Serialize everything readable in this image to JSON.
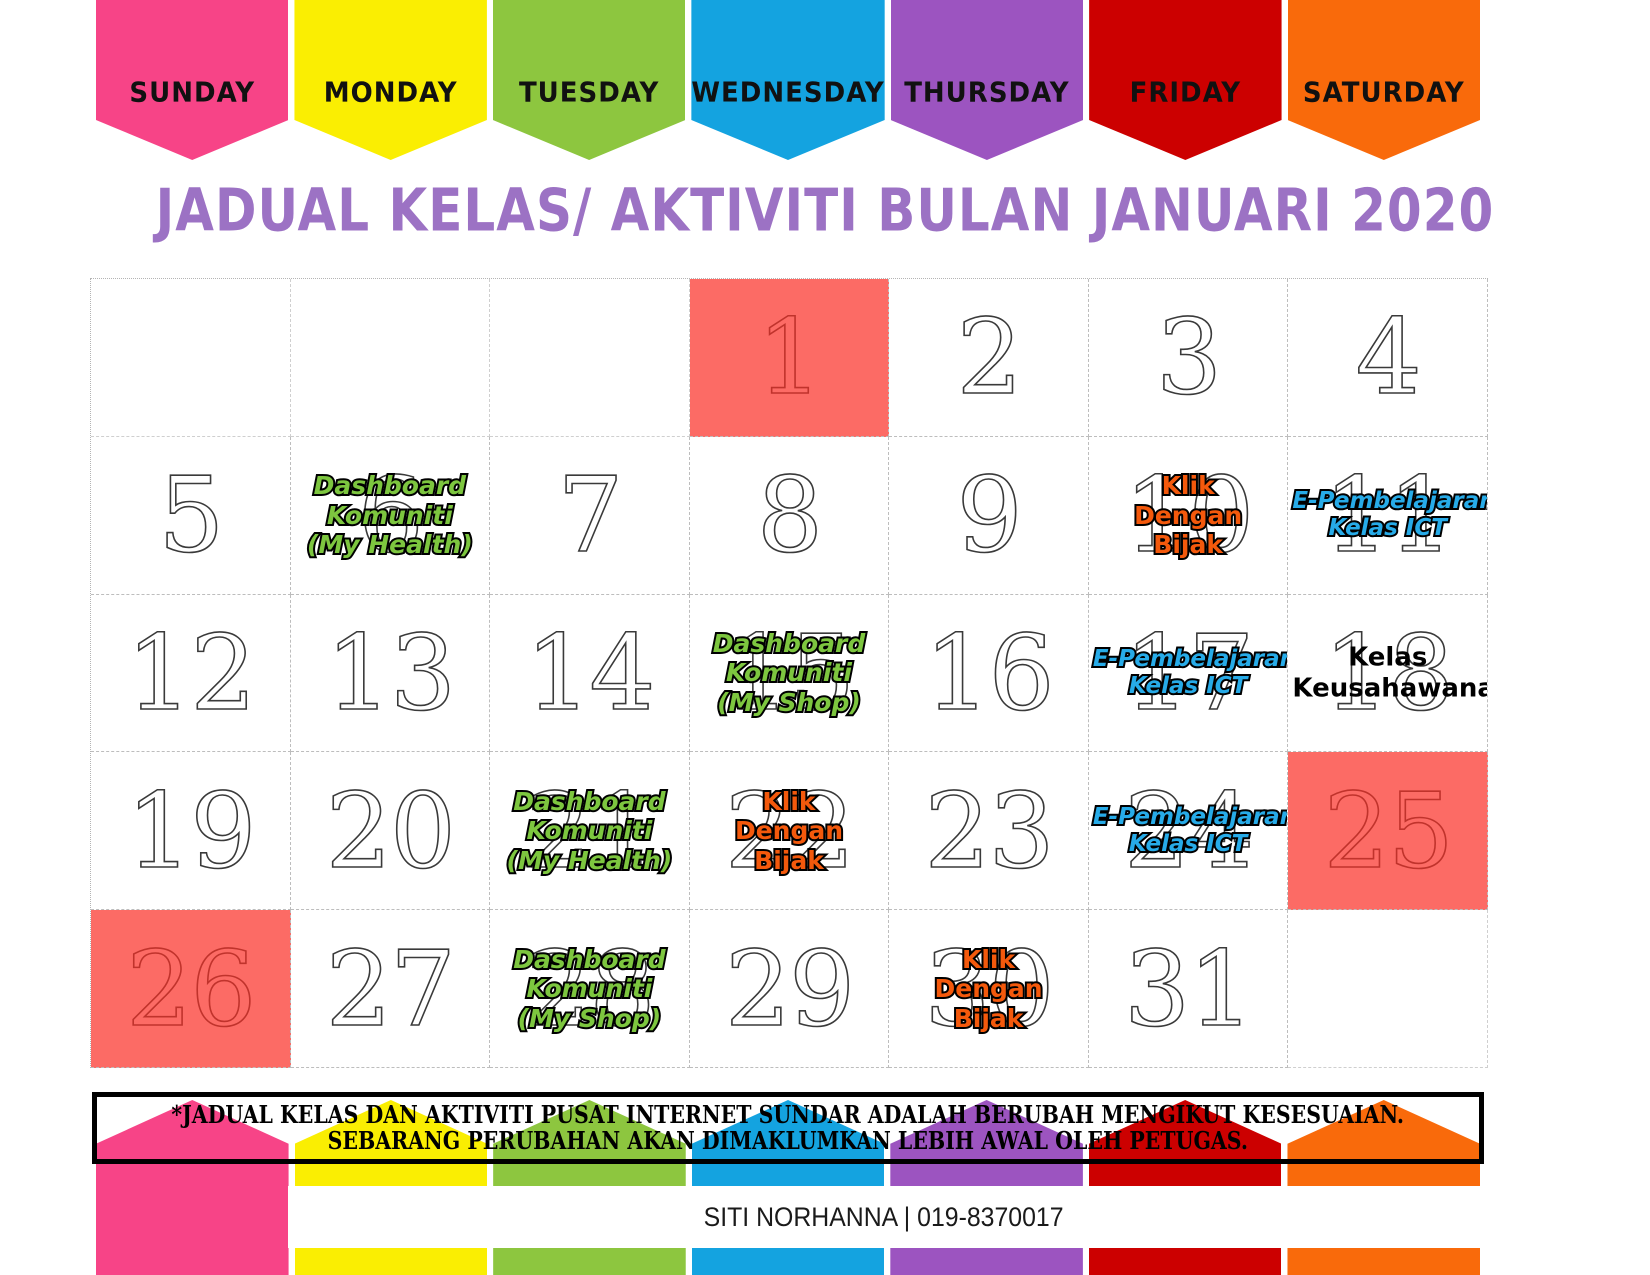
{
  "title": "JADUAL KELAS/ AKTIVITI BULAN JANUARI 2020",
  "days": [
    {
      "label": "SUNDAY",
      "color": "#F74487"
    },
    {
      "label": "MONDAY",
      "color": "#FAEE02"
    },
    {
      "label": "TUESDAY",
      "color": "#8DC63F"
    },
    {
      "label": "WEDNESDAY",
      "color": "#14A3E0"
    },
    {
      "label": "THURSDAY",
      "color": "#9C54C0"
    },
    {
      "label": "FRIDAY",
      "color": "#CC0000"
    },
    {
      "label": "SATURDAY",
      "color": "#F96A0B"
    }
  ],
  "highlight_color": "#FC6B65",
  "activity_colors": {
    "green": "#7DC63F",
    "orange": "#F4590C",
    "blue": "#27ABE8",
    "plain": "#000000"
  },
  "cells": [
    {
      "num": "",
      "activity": [],
      "style": "",
      "highlight": false,
      "empty": true
    },
    {
      "num": "",
      "activity": [],
      "style": "",
      "highlight": false,
      "empty": true
    },
    {
      "num": "",
      "activity": [],
      "style": "",
      "highlight": false,
      "empty": true
    },
    {
      "num": "1",
      "activity": [],
      "style": "",
      "highlight": true,
      "empty": false
    },
    {
      "num": "2",
      "activity": [],
      "style": "",
      "highlight": false,
      "empty": false
    },
    {
      "num": "3",
      "activity": [],
      "style": "",
      "highlight": false,
      "empty": false
    },
    {
      "num": "4",
      "activity": [],
      "style": "",
      "highlight": false,
      "empty": false
    },
    {
      "num": "5",
      "activity": [],
      "style": "",
      "highlight": false,
      "empty": false
    },
    {
      "num": "6",
      "activity": [
        "Dashboard",
        "Komuniti",
        "(My Health)"
      ],
      "style": "style-green",
      "highlight": false,
      "empty": false
    },
    {
      "num": "7",
      "activity": [],
      "style": "",
      "highlight": false,
      "empty": false
    },
    {
      "num": "8",
      "activity": [],
      "style": "",
      "highlight": false,
      "empty": false
    },
    {
      "num": "9",
      "activity": [],
      "style": "",
      "highlight": false,
      "empty": false
    },
    {
      "num": "10",
      "activity": [
        "Klik",
        "Dengan",
        "Bijak"
      ],
      "style": "style-orange",
      "highlight": false,
      "empty": false
    },
    {
      "num": "11",
      "activity": [
        "E-Pembelajaran",
        "Kelas ICT"
      ],
      "style": "style-blue",
      "highlight": false,
      "empty": false
    },
    {
      "num": "12",
      "activity": [],
      "style": "",
      "highlight": false,
      "empty": false
    },
    {
      "num": "13",
      "activity": [],
      "style": "",
      "highlight": false,
      "empty": false
    },
    {
      "num": "14",
      "activity": [],
      "style": "",
      "highlight": false,
      "empty": false
    },
    {
      "num": "15",
      "activity": [
        "Dashboard",
        "Komuniti",
        "(My Shop)"
      ],
      "style": "style-green",
      "highlight": false,
      "empty": false
    },
    {
      "num": "16",
      "activity": [],
      "style": "",
      "highlight": false,
      "empty": false
    },
    {
      "num": "17",
      "activity": [
        "E-Pembelajaran",
        "Kelas ICT"
      ],
      "style": "style-blue",
      "highlight": false,
      "empty": false
    },
    {
      "num": "18",
      "activity": [
        "Kelas",
        "Keusahawanan"
      ],
      "style": "style-plain",
      "highlight": false,
      "empty": false
    },
    {
      "num": "19",
      "activity": [],
      "style": "",
      "highlight": false,
      "empty": false
    },
    {
      "num": "20",
      "activity": [],
      "style": "",
      "highlight": false,
      "empty": false
    },
    {
      "num": "21",
      "activity": [
        "Dashboard",
        "Komuniti",
        "(My Health)"
      ],
      "style": "style-green",
      "highlight": false,
      "empty": false
    },
    {
      "num": "22",
      "activity": [
        "Klik",
        "Dengan",
        "Bijak"
      ],
      "style": "style-orange",
      "highlight": false,
      "empty": false
    },
    {
      "num": "23",
      "activity": [],
      "style": "",
      "highlight": false,
      "empty": false
    },
    {
      "num": "24",
      "activity": [
        "E-Pembelajaran",
        "Kelas ICT"
      ],
      "style": "style-blue",
      "highlight": false,
      "empty": false
    },
    {
      "num": "25",
      "activity": [],
      "style": "",
      "highlight": true,
      "empty": false
    },
    {
      "num": "26",
      "activity": [],
      "style": "",
      "highlight": true,
      "empty": false
    },
    {
      "num": "27",
      "activity": [],
      "style": "",
      "highlight": false,
      "empty": false
    },
    {
      "num": "28",
      "activity": [
        "Dashboard",
        "Komuniti",
        "(My Shop)"
      ],
      "style": "style-green",
      "highlight": false,
      "empty": false
    },
    {
      "num": "29",
      "activity": [],
      "style": "",
      "highlight": false,
      "empty": false
    },
    {
      "num": "30",
      "activity": [
        "Klik",
        "Dengan",
        "Bijak"
      ],
      "style": "style-orange",
      "highlight": false,
      "empty": false
    },
    {
      "num": "31",
      "activity": [],
      "style": "",
      "highlight": false,
      "empty": false
    },
    {
      "num": "",
      "activity": [],
      "style": "",
      "highlight": false,
      "empty": true
    }
  ],
  "footer": {
    "note_line_1": "*JADUAL KELAS DAN AKTIVITI PUSAT INTERNET SUNDAR ADALAH BERUBAH MENGIKUT KESESUAIAN.",
    "note_line_2": "SEBARANG PERUBAHAN AKAN DIMAKLUMKAN LEBIH AWAL OLEH PETUGAS.",
    "contact": "SITI NORHANNA | 019-8370017"
  }
}
